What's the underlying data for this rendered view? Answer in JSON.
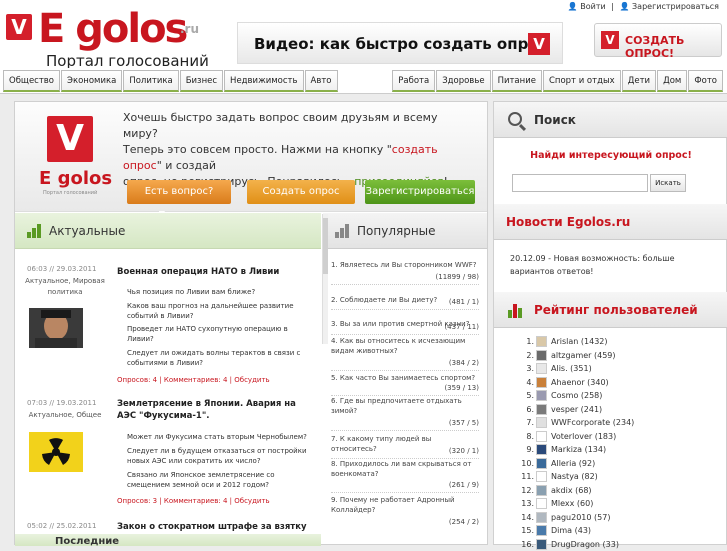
{
  "header": {
    "logo_word": "E golos",
    "logo_tld": ".ru",
    "logo_subtitle": "Портал голосований",
    "logo_check": "V",
    "banner_text": "Видео: как быстро создать опрос",
    "top_links": [
      "Войти",
      "|",
      "Зарегистрироваться"
    ],
    "create_button": "СОЗДАТЬ ОПРОС!"
  },
  "nav": {
    "left": [
      "Общество",
      "Экономика",
      "Политика",
      "Бизнес",
      "Недвижимость",
      "Авто"
    ],
    "right": [
      "Работа",
      "Здоровье",
      "Питание",
      "Спорт и отдых",
      "Дети",
      "Дом",
      "Фото"
    ]
  },
  "promo": {
    "logo_word": "E golos",
    "logo_sub": "Портал голосований",
    "line1": "Хочешь быстро задать вопрос своим друзьям и всему миру?",
    "line2a": "Теперь это совсем просто. Нажми на кнопку \"",
    "line2_link": "создать опрос",
    "line2b": "\" и создай",
    "line3a": "опрос, не регистрирусь. Понравилось - ",
    "line3_link": "присоединяйся",
    "line3b": "!",
    "btn_ask": "Есть вопрос? Пишите",
    "btn_create": "Создать опрос",
    "btn_register": "Зарегистрироваться"
  },
  "actual": {
    "title": "Актуальные",
    "items": [
      {
        "date": "06:03 // 29.03.2011",
        "cats": "Актуальное, Мировая политика",
        "title": "Военная операция НАТО в Ливии",
        "questions": [
          "Чья позиция по Ливии вам ближе?",
          "Каков ваш прогноз на дальнейшее развитие событий в Ливии?",
          "Проведет ли НАТО сухопутную операцию в Ливии?",
          "Следует ли ожидать волны терактов в связи с событиями в Ливии?"
        ],
        "links": "Опросов: 4 | Комментариев: 4 | Обсудить"
      },
      {
        "date": "07:03 // 19.03.2011",
        "cats": "Актуальное, Общее",
        "title": "Землетрясение в Японии. Авария на АЭС \"Фукусима-1\".",
        "questions": [
          "Может ли Фукусима стать вторым Чернобылем?",
          "Следует ли в будущем отказаться от постройки новых АЭС или сократить их число?",
          "Связано ли Японское землетрясение со смещением земной оси и 2012 годом?"
        ],
        "links": "Опросов: 3 | Комментариев: 4 | Обсудить"
      },
      {
        "date": "05:02 // 25.02.2011",
        "title": "Закон о стократном штрафе за взятку"
      }
    ],
    "bottom_label": "Последние"
  },
  "popular": {
    "title": "Популярные",
    "items": [
      {
        "text": "1. Являетесь ли Вы сторонником WWF?",
        "count": "(11899 / 98)"
      },
      {
        "text": "2. Соблюдаете ли Вы диету?",
        "count": "(481 / 1)"
      },
      {
        "text": "3. Вы за или против смертной казни?",
        "count": "(437 / 11)"
      },
      {
        "text": "4. Как вы относитесь к исчезающим видам животных?",
        "count": "(384 / 2)"
      },
      {
        "text": "5. Как часто Вы занимаетесь спортом?",
        "count": "(359 / 13)"
      },
      {
        "text": "6. Где вы предпочитаете отдыхать зимой?",
        "count": "(357 / 5)"
      },
      {
        "text": "7. К какому типу людей вы относитесь?",
        "count": "(320 / 1)"
      },
      {
        "text": "8. Приходилось ли вам скрываться от военкомата?",
        "count": "(261 / 9)"
      },
      {
        "text": "9. Почему не работает Адронный Коллайдер?",
        "count": "(254 / 2)"
      }
    ]
  },
  "sidebar": {
    "search_title": "Поиск",
    "search_tagline": "Найди интересующий опрос!",
    "search_placeholder": "",
    "search_button": "Искать",
    "news_title": "Новости Egolos.ru",
    "news_text": "20.12.09 - Новая возможность: больше вариантов ответов!",
    "rating_title": "Рейтинг пользователей",
    "rating": [
      {
        "num": "1.",
        "name": "Arislan (1432)"
      },
      {
        "num": "2.",
        "name": "altzgamer (459)"
      },
      {
        "num": "3.",
        "name": "Alis. (351)"
      },
      {
        "num": "4.",
        "name": "Ahaenor (340)"
      },
      {
        "num": "5.",
        "name": "Cosmo (258)"
      },
      {
        "num": "6.",
        "name": "vesper (241)"
      },
      {
        "num": "7.",
        "name": "WWFcorporate (234)"
      },
      {
        "num": "8.",
        "name": "Voterlover (183)"
      },
      {
        "num": "9.",
        "name": "Markiza (134)"
      },
      {
        "num": "10.",
        "name": "Alleria (92)"
      },
      {
        "num": "11.",
        "name": "Nastya (82)"
      },
      {
        "num": "12.",
        "name": "akdix (68)"
      },
      {
        "num": "13.",
        "name": "Mlexx (60)"
      },
      {
        "num": "14.",
        "name": "pagu2010 (57)"
      },
      {
        "num": "15.",
        "name": "Dima (43)"
      },
      {
        "num": "16.",
        "name": "DrugDragon (33)"
      }
    ]
  },
  "colors": {
    "brand_red": "#c8161f",
    "accent_green": "#5a9a23"
  }
}
